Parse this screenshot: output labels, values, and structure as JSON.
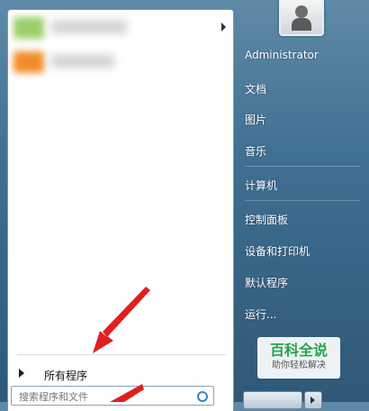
{
  "left_pane": {
    "all_programs_label": "所有程序",
    "search_placeholder": "搜索程序和文件"
  },
  "right_pane": {
    "user_name": "Administrator",
    "links": [
      "文档",
      "图片",
      "音乐",
      "计算机",
      "控制面板",
      "设备和打印机",
      "默认程序",
      "运行..."
    ]
  },
  "watermark": {
    "title": "百科全说",
    "subtitle": "助你轻松解决"
  },
  "colors": {
    "annotation_arrow": "#e02020",
    "watermark_green": "#25a34a",
    "right_pane_bg": "#3f6f92"
  }
}
